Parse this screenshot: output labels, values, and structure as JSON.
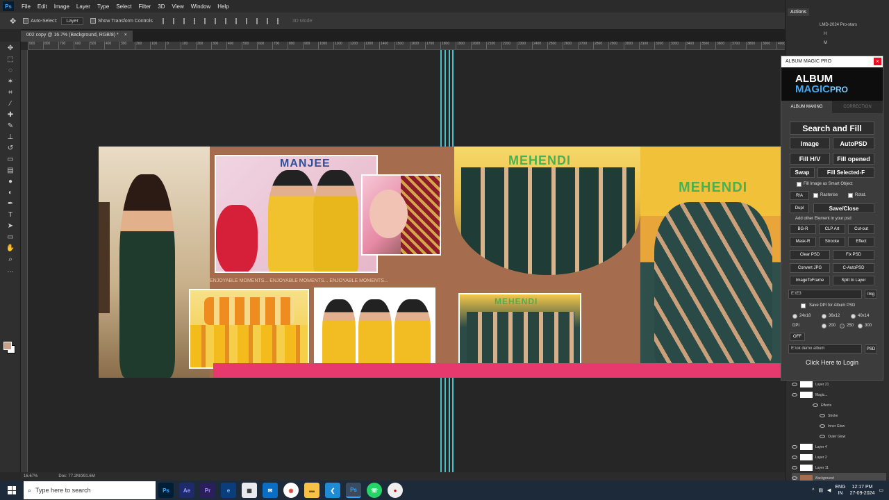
{
  "menubar": {
    "items": [
      "File",
      "Edit",
      "Image",
      "Layer",
      "Type",
      "Select",
      "Filter",
      "3D",
      "View",
      "Window",
      "Help"
    ]
  },
  "options": {
    "auto_select": "Auto-Select:",
    "layer_select": "Layer",
    "transform": "Show Transform Controls",
    "mode_3d": "3D Mode:"
  },
  "document": {
    "tab_label": "002 copy @ 16.7% (Background, RGB/8) *",
    "zoom": "16.67%",
    "doc_size": "Doc: 77.2M/391.6M",
    "label_manjee": "MANJEE",
    "label_mehendi_1": "MEHENDI",
    "label_mehendi_2": "MEHENDI",
    "label_mehendi_3": "MEHENDI",
    "caption": "ENJOYABLE MOMENTS... ENJOYABLE MOMENTS... ENJOYABLE MOMENTS..."
  },
  "ruler_marks": [
    "900",
    "800",
    "700",
    "600",
    "500",
    "400",
    "300",
    "200",
    "100",
    "0",
    "100",
    "200",
    "300",
    "400",
    "500",
    "600",
    "700",
    "800",
    "900",
    "1000",
    "1100",
    "1200",
    "1300",
    "1400",
    "1500",
    "1600",
    "1700",
    "1800",
    "1900",
    "2000",
    "2100",
    "2200",
    "2300",
    "2400",
    "2500",
    "2600",
    "2700",
    "2800",
    "2900",
    "3000",
    "3100",
    "3200",
    "3300",
    "3400",
    "3500",
    "3600",
    "3700",
    "3800",
    "3900",
    "4000",
    "4100"
  ],
  "actions": {
    "title": "Actions",
    "rows": [
      "LMD-2024 Pro-stars",
      "H",
      "M"
    ]
  },
  "amp": {
    "window_title": "ALBUM MAGIC PRO",
    "logo_line1": "ALBUM",
    "logo_line2": "MAGIC",
    "logo_pro": "PRO",
    "tab_album": "ALBUM MAKING",
    "tab_correction": "CORRECTION",
    "search_fill": "Search and Fill",
    "image": "Image",
    "autopsd": "AutoPSD",
    "fill_hv": "Fill H/V",
    "fill_opened": "Fill opened",
    "swap": "Swap",
    "fill_selected": "Fill Selected-F",
    "smart_object": "Fill Image as Smart Object",
    "ra": "R/A",
    "rasterise": "Rasterise",
    "rotat": "Rotat.",
    "dupl": "Dupl",
    "save_close": "Save/Close",
    "add_other": "Add other Element in your psd",
    "bgr": "BG-R",
    "clp_art": "CLP Art",
    "cutout": "Cut-out",
    "mask_r": "Mask-R",
    "stroke": "Strocke",
    "effect": "Effect",
    "clear_psd": "Clear PSD",
    "fix_psd": "Fix PSD",
    "convert_jpg": "Convert JPG",
    "c_autopsd": "C-AutoPSD",
    "image_to_frame": "ImageToFrame",
    "split_layer": "Split to Layer",
    "path_value": "E:\\E3",
    "img": "Img",
    "save_dpi": "Save DPI for Album PSD",
    "size_1": "24x18",
    "size_2": "36x12",
    "size_3": "40x14",
    "dpi_label": "DPI",
    "dpi_1": "200",
    "dpi_2": "250",
    "dpi_3": "300",
    "off": "OFF",
    "demo_path": "E:\\ok demo album",
    "psd": "PSD",
    "login": "Click Here to Login"
  },
  "layers": [
    {
      "name": "Layer 21"
    },
    {
      "name": "Magic..."
    },
    {
      "name": "Effects"
    },
    {
      "name": "Stroke"
    },
    {
      "name": "Inner Glow"
    },
    {
      "name": "Outer Glow"
    },
    {
      "name": "Layer 4"
    },
    {
      "name": "Layer 2"
    },
    {
      "name": "Layer 11"
    },
    {
      "name": "Background"
    }
  ],
  "taskbar": {
    "search_placeholder": "Type here to search",
    "lang": "ENG",
    "region": "IN",
    "time": "12:17 PM",
    "date": "27-09-2024"
  }
}
